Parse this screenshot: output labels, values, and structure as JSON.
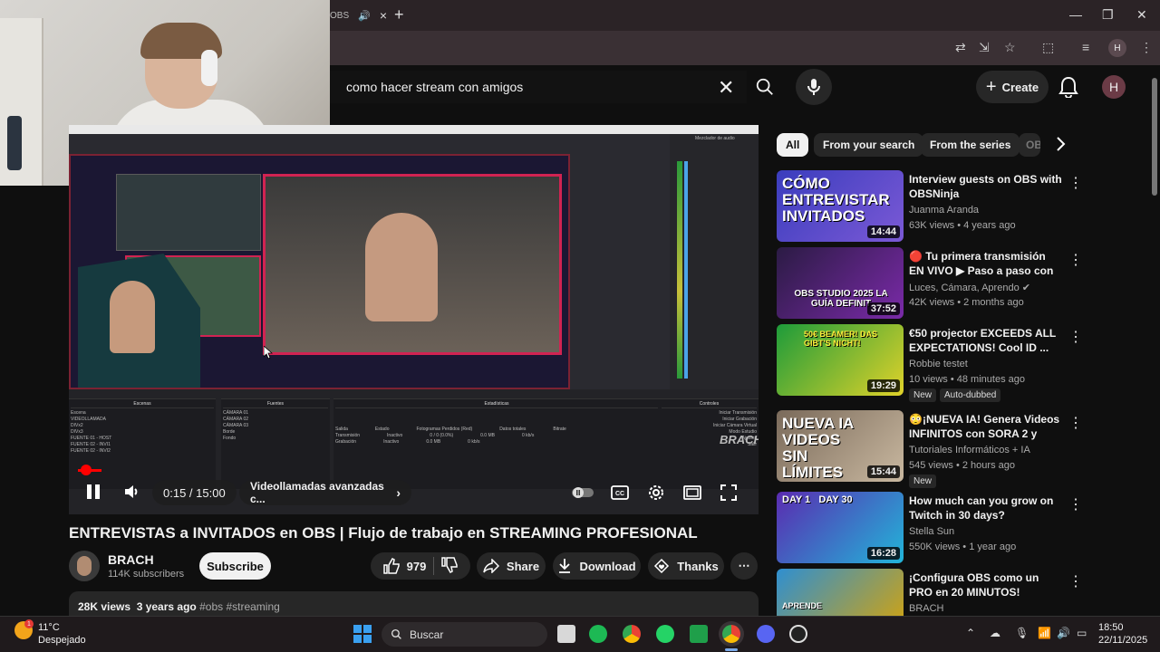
{
  "browser": {
    "tab_close": "×",
    "new_tab": "+",
    "window_controls": {
      "minimize": "—",
      "maximize": "❐",
      "close": "✕"
    },
    "profile_initial": "H"
  },
  "header": {
    "search_value": "como hacer stream con amigos",
    "create_label": "Create",
    "avatar_initial": "H"
  },
  "player": {
    "scene_dock_title": "Escenas",
    "scenes": [
      "Escena",
      "VIDEOLLAMADA",
      "DIVx2",
      "DIVx3",
      "FUENTE 01 - HOST",
      "FUENTE 02 - INVI1",
      "FUENTE 02 - INVI2"
    ],
    "sources_dock_title": "Fuentes",
    "sources": [
      "CÁMARA 01",
      "CÁMARA 02",
      "CÁMARA 03",
      "Borde",
      "Fondo"
    ],
    "stats_dock_title": "Estadísticas",
    "stats_headers": [
      "Salida",
      "Estado",
      "Fotogramas Perdidos (Red)",
      "Datos totales",
      "Bitrate"
    ],
    "stats_rows": [
      [
        "Transmisión",
        "Inactivo",
        "0 / 0 (0.0%)",
        "0.0 MB",
        "0 kb/s"
      ],
      [
        "Grabación",
        "Inactivo",
        "",
        "0.0 MB",
        "0 kb/s"
      ]
    ],
    "controls_dock_title": "Controles",
    "controls": [
      "Iniciar Transmisión",
      "Iniciar Grabación",
      "Iniciar Cámara Virtual",
      "Modo Estudio",
      "Ajustes",
      "Salir"
    ],
    "mixer_title": "Mezclador de audio",
    "watermark": "BRACH",
    "current_time": "0:15",
    "duration": "15:00",
    "time_separator": " / ",
    "chapter": "Videollamadas avanzadas c...",
    "progress_fraction": 0.017
  },
  "video": {
    "title": "ENTREVISTAS a INVITADOS en OBS | Flujo de trabajo en STREAMING PROFESIONAL",
    "channel": "BRACH",
    "subscribers": "114K subscribers",
    "subscribe_label": "Subscribe",
    "likes": "979",
    "share_label": "Share",
    "download_label": "Download",
    "thanks_label": "Thanks",
    "views_date": "28K views  3 years ago",
    "tags": "#obs #streaming"
  },
  "chips": [
    "All",
    "From your search",
    "From the series",
    "OB"
  ],
  "sidebar": {
    "videos": [
      {
        "thumb_text": "CÓMO ENTREVISTAR INVITADOS",
        "title": "Interview guests on OBS with OBSNinja",
        "channel": "Juanma Aranda",
        "meta": "63K views • 4 years ago",
        "duration": "14:44"
      },
      {
        "thumb_text": "OBS STUDIO 2025 LA GUÍA DEFINIT",
        "title": "🔴 Tu primera transmisión EN VIVO ▶ Paso a paso con OBS ...",
        "channel": "Luces, Cámara, Aprendo ✔",
        "meta": "42K views • 2 months ago",
        "duration": "37:52"
      },
      {
        "thumb_text": "50€ BEAMER! DAS GIBT'S NICHT!",
        "title": "€50 projector EXCEEDS ALL EXPECTATIONS! Cool ID ...",
        "channel": "Robbie testet",
        "meta": "10 views • 48 minutes ago",
        "duration": "19:29",
        "badge": "New",
        "badge2": "Auto-dubbed"
      },
      {
        "thumb_text": "NUEVA IA VIDEOS SIN LÍMITES",
        "title": "😳¡NUEVA IA! Genera Videos INFINITOS con SORA 2 y VEO ...",
        "channel": "Tutoriales Informáticos + IA",
        "meta": "545 views • 2 hours ago",
        "duration": "15:44",
        "badge": "New"
      },
      {
        "thumb_text": "DAY 1   DAY 30",
        "title": "How much can you grow on Twitch in 30 days?",
        "channel": "Stella Sun",
        "meta": "550K views • 1 year ago",
        "duration": "16:28"
      },
      {
        "thumb_text": "APRENDE",
        "title": "¡Configura OBS como un PRO en 20 MINUTOS!",
        "channel": "BRACH",
        "meta": "",
        "duration": ""
      }
    ]
  },
  "taskbar": {
    "temperature": "11°C",
    "weather": "Despejado",
    "weather_badge": "1",
    "search_label": "Buscar",
    "time": "18:50",
    "date": "22/11/2025"
  }
}
